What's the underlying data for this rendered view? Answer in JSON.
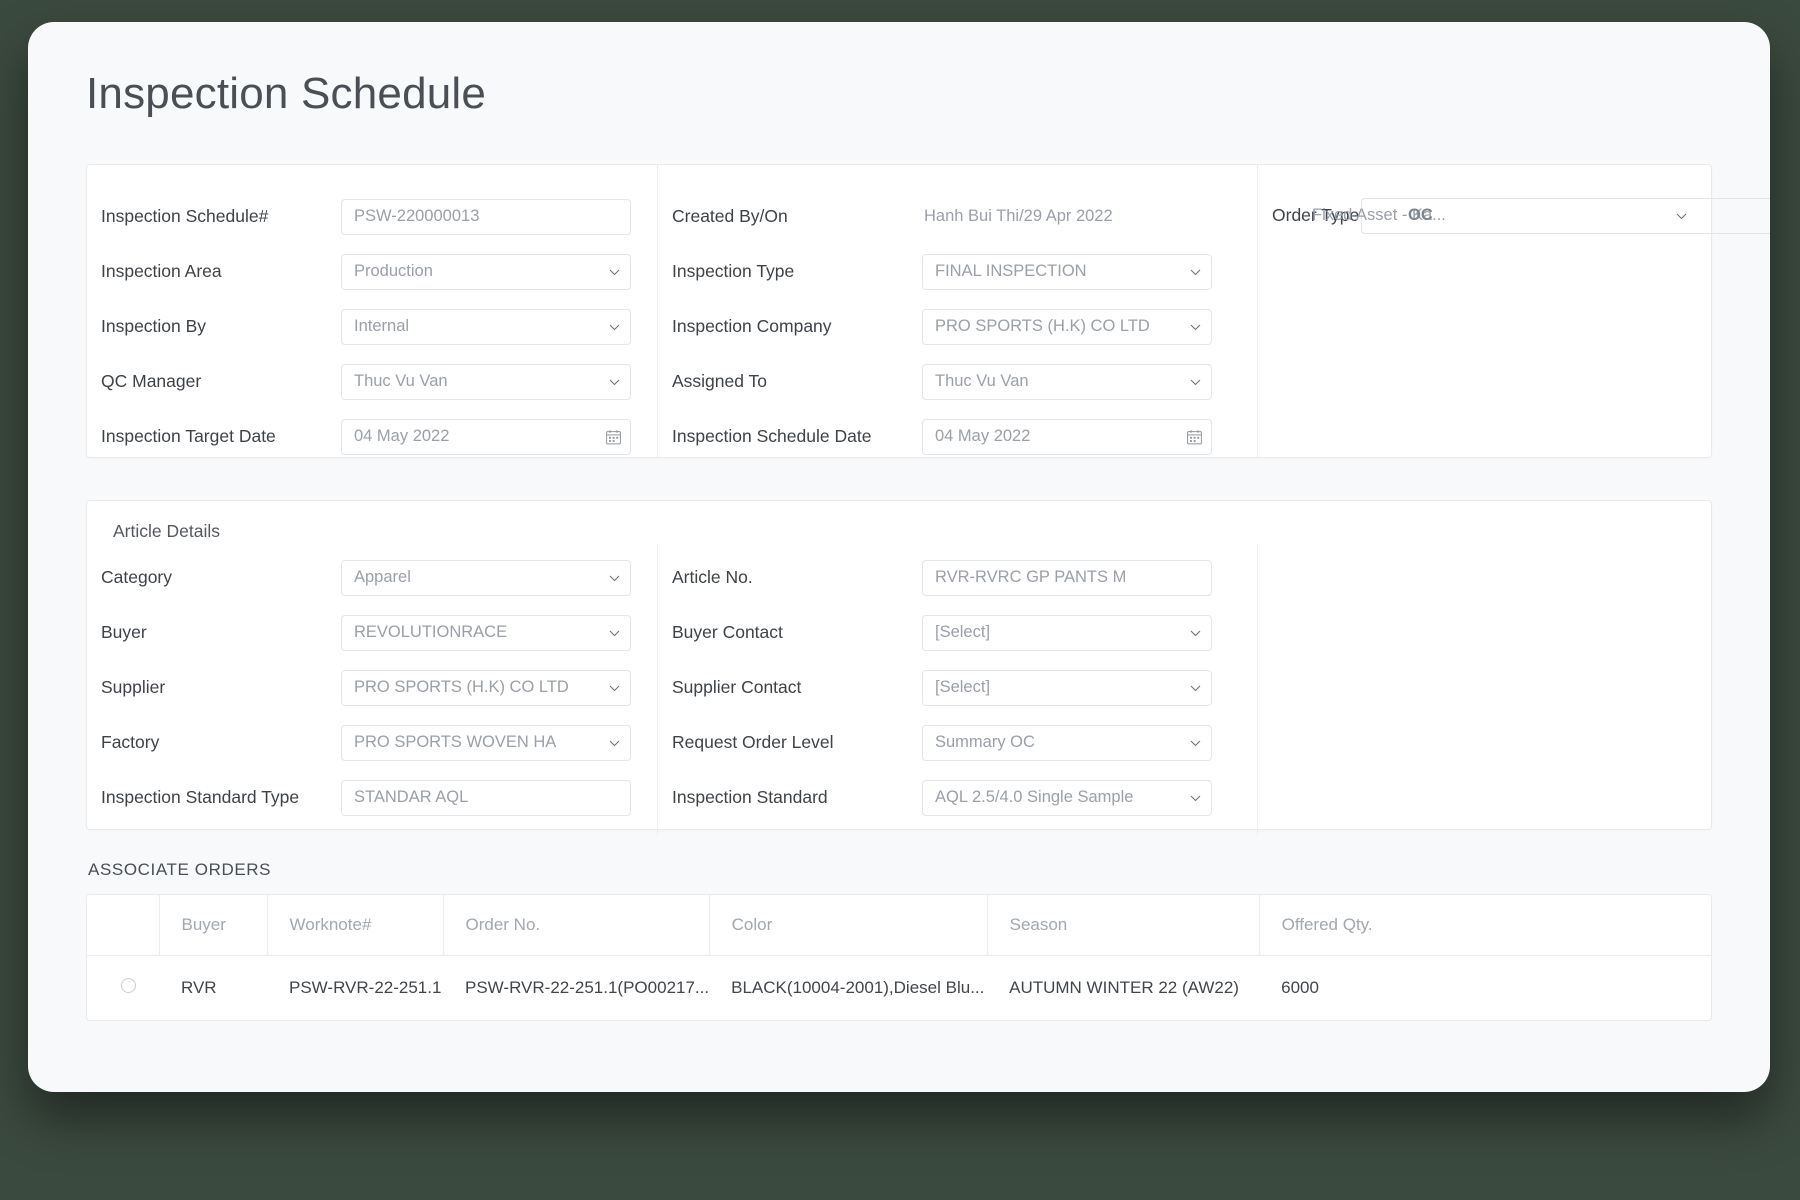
{
  "page": {
    "title": "Inspection Schedule"
  },
  "main_section": {
    "left": [
      {
        "label": "Inspection Schedule#",
        "value": "PSW-220000013",
        "control": "text"
      },
      {
        "label": "Inspection Area",
        "value": "Production",
        "control": "select"
      },
      {
        "label": "Inspection By",
        "value": "Internal",
        "control": "select"
      },
      {
        "label": "QC Manager",
        "value": "Thuc Vu Van",
        "control": "select"
      },
      {
        "label": "Inspection Target Date",
        "value": "04 May 2022",
        "control": "date"
      }
    ],
    "middle": [
      {
        "label": "Created By/On",
        "value": "Hanh Bui Thi/29 Apr 2022",
        "control": "static"
      },
      {
        "label": "Inspection Type",
        "value": "FINAL INSPECTION",
        "control": "select"
      },
      {
        "label": "Inspection Company",
        "value": "PRO SPORTS (H.K) CO LTD",
        "control": "select"
      },
      {
        "label": "Assigned To",
        "value": "Thuc Vu Van",
        "control": "select"
      },
      {
        "label": "Inspection Schedule Date",
        "value": "04 May 2022",
        "control": "date"
      }
    ],
    "right": {
      "label": "Order Type",
      "value": "Fixed Asset - Ka...",
      "extra": "OC"
    }
  },
  "article_details": {
    "section_label": "Article Details",
    "left": [
      {
        "label": "Category",
        "value": "Apparel",
        "control": "select"
      },
      {
        "label": "Buyer",
        "value": "REVOLUTIONRACE",
        "control": "select"
      },
      {
        "label": "Supplier",
        "value": "PRO SPORTS (H.K) CO LTD",
        "control": "select"
      },
      {
        "label": "Factory",
        "value": "PRO SPORTS WOVEN HA",
        "control": "select"
      },
      {
        "label": "Inspection Standard Type",
        "value": "STANDAR AQL",
        "control": "text"
      }
    ],
    "right": [
      {
        "label": "Article No.",
        "value": "RVR-RVRC GP PANTS M",
        "control": "text"
      },
      {
        "label": "Buyer Contact",
        "value": "[Select]",
        "control": "select"
      },
      {
        "label": "Supplier Contact",
        "value": "[Select]",
        "control": "select"
      },
      {
        "label": "Request Order Level",
        "value": "Summary OC",
        "control": "select"
      },
      {
        "label": "Inspection Standard",
        "value": "AQL 2.5/4.0 Single Sample",
        "control": "select"
      }
    ]
  },
  "associate_orders": {
    "title": "ASSOCIATE ORDERS",
    "columns": [
      "",
      "Buyer",
      "Worknote#",
      "Order No.",
      "Color",
      "Season",
      "Offered Qty."
    ],
    "rows": [
      {
        "selected": false,
        "buyer": "RVR",
        "worknote": "PSW-RVR-22-251.1",
        "order_no": "PSW-RVR-22-251.1(PO00217...",
        "color": "BLACK(10004-2001),Diesel Blu...",
        "season": "AUTUMN WINTER 22 (AW22)",
        "offered_qty": "6000"
      }
    ]
  },
  "colors": {
    "page_bg": "#f8f9fa",
    "card_bg": "#ffffff",
    "border": "#e8eaec",
    "label_text": "#3e4348",
    "value_text": "#9aa0a8",
    "desktop_bg": "#3b4a3f"
  }
}
